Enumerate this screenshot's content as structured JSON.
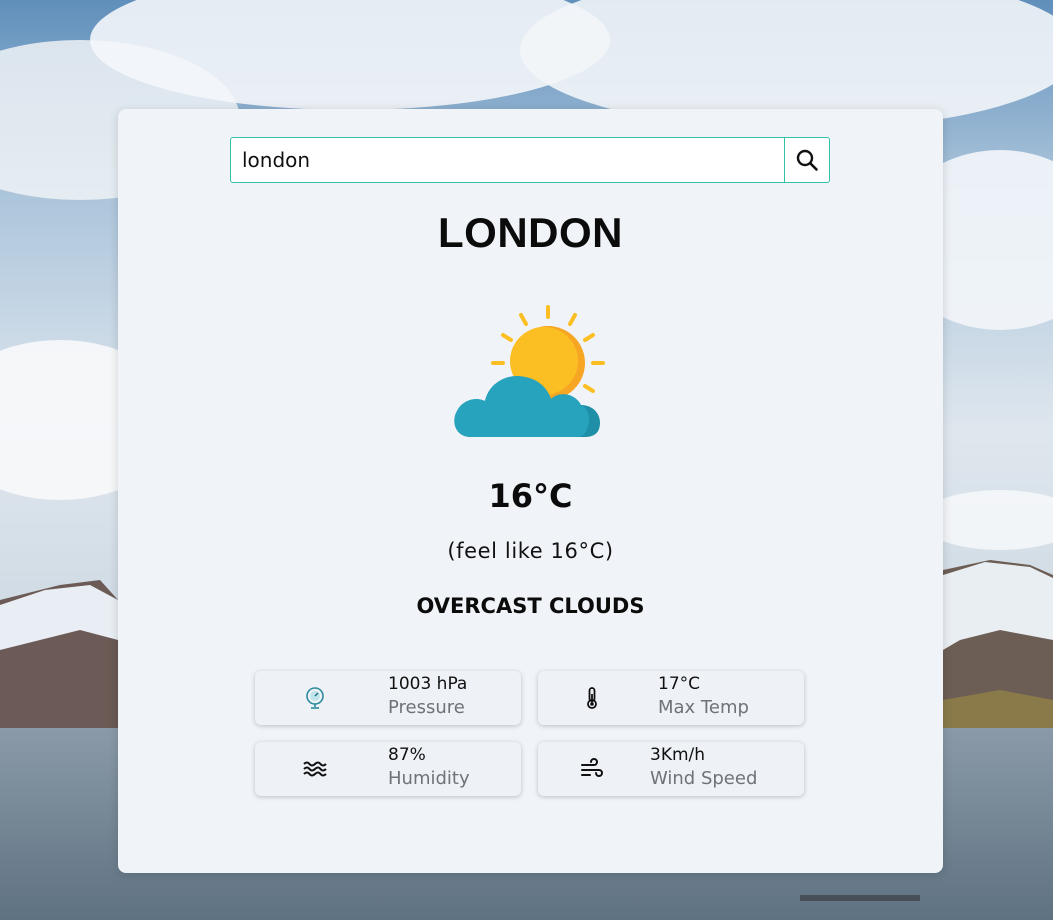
{
  "search": {
    "value": "london",
    "button_icon": "search-icon"
  },
  "city": "LONDON",
  "weather": {
    "icon": "partly-cloudy-sun-icon",
    "temperature": "16°C",
    "feels_like": "(feel like 16°C)",
    "description": "OVERCAST CLOUDS"
  },
  "stats": {
    "pressure": {
      "value": "1003 hPa",
      "label": "Pressure",
      "icon": "barometer-icon"
    },
    "max_temp": {
      "value": "17°C",
      "label": "Max Temp",
      "icon": "thermometer-icon"
    },
    "humidity": {
      "value": "87%",
      "label": "Humidity",
      "icon": "waves-icon"
    },
    "wind": {
      "value": "3Km/h",
      "label": "Wind Speed",
      "icon": "wind-icon"
    }
  },
  "colors": {
    "accent_border": "#33c2a8",
    "card_bg": "#f0f3f8",
    "sun": "#fbbf24",
    "cloud": "#27a3bd"
  }
}
